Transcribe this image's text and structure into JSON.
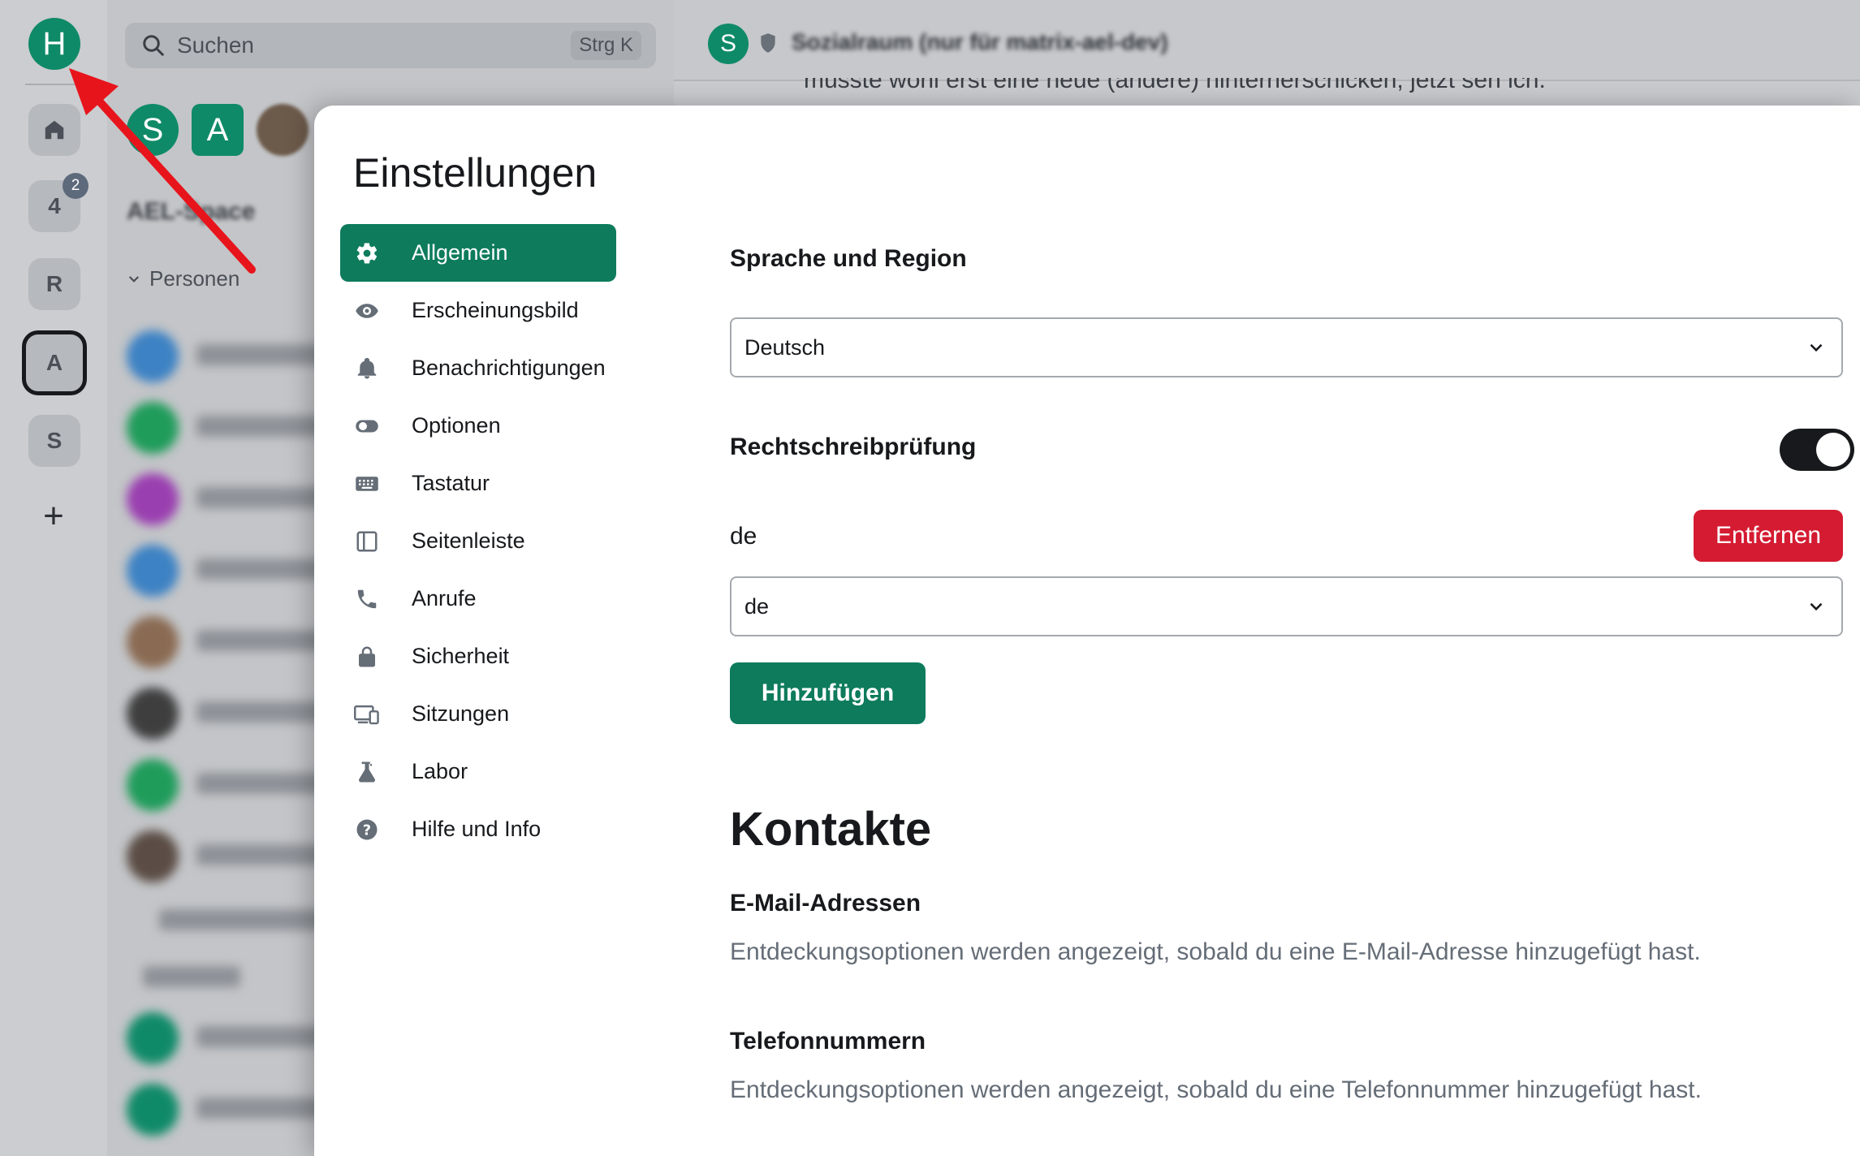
{
  "rail": {
    "home_avatar": "H",
    "items": [
      {
        "label": "",
        "icon": "home-icon"
      },
      {
        "label": "4",
        "badge": "2"
      },
      {
        "label": "R"
      },
      {
        "label": "A",
        "selected": true
      },
      {
        "label": "S"
      }
    ],
    "add_label": "+"
  },
  "room_list": {
    "search_label": "Suchen",
    "search_shortcut": "Strg K",
    "top_avatars": [
      "S",
      "A"
    ],
    "space_name": "AEL-Space",
    "section_people": "Personen"
  },
  "room_header": {
    "avatar": "S",
    "title": "Sozialraum (nur für matrix-ael-dev)",
    "message_snippet": "müsste wohl erst eine neue (andere) hinterherschicken, jetzt seh ich."
  },
  "settings": {
    "title": "Einstellungen",
    "nav": [
      {
        "label": "Allgemein",
        "icon": "gear-icon",
        "active": true
      },
      {
        "label": "Erscheinungsbild",
        "icon": "eye-icon"
      },
      {
        "label": "Benachrichtigungen",
        "icon": "bell-icon"
      },
      {
        "label": "Optionen",
        "icon": "toggle-icon"
      },
      {
        "label": "Tastatur",
        "icon": "keyboard-icon"
      },
      {
        "label": "Seitenleiste",
        "icon": "sidebar-icon"
      },
      {
        "label": "Anrufe",
        "icon": "phone-icon"
      },
      {
        "label": "Sicherheit",
        "icon": "lock-icon"
      },
      {
        "label": "Sitzungen",
        "icon": "devices-icon"
      },
      {
        "label": "Labor",
        "icon": "flask-icon"
      },
      {
        "label": "Hilfe und Info",
        "icon": "help-icon"
      }
    ],
    "general": {
      "language_heading": "Sprache und Region",
      "language_value": "Deutsch",
      "spellcheck_heading": "Rechtschreibprüfung",
      "spellcheck_enabled": true,
      "spellcheck_language": "de",
      "remove_button": "Entfernen",
      "add_language_value": "de",
      "add_button": "Hinzufügen",
      "contacts_heading": "Kontakte",
      "emails_heading": "E-Mail-Adressen",
      "emails_text": "Entdeckungsoptionen werden angezeigt, sobald du eine E-Mail-Adresse hinzugefügt hast.",
      "phones_heading": "Telefonnummern",
      "phones_text": "Entdeckungsoptionen werden angezeigt, sobald du eine Telefonnummer hinzugefügt hast."
    }
  },
  "colors": {
    "accent": "#0d7b5c",
    "danger": "#d41b31",
    "annotation_arrow": "#e8141c"
  }
}
